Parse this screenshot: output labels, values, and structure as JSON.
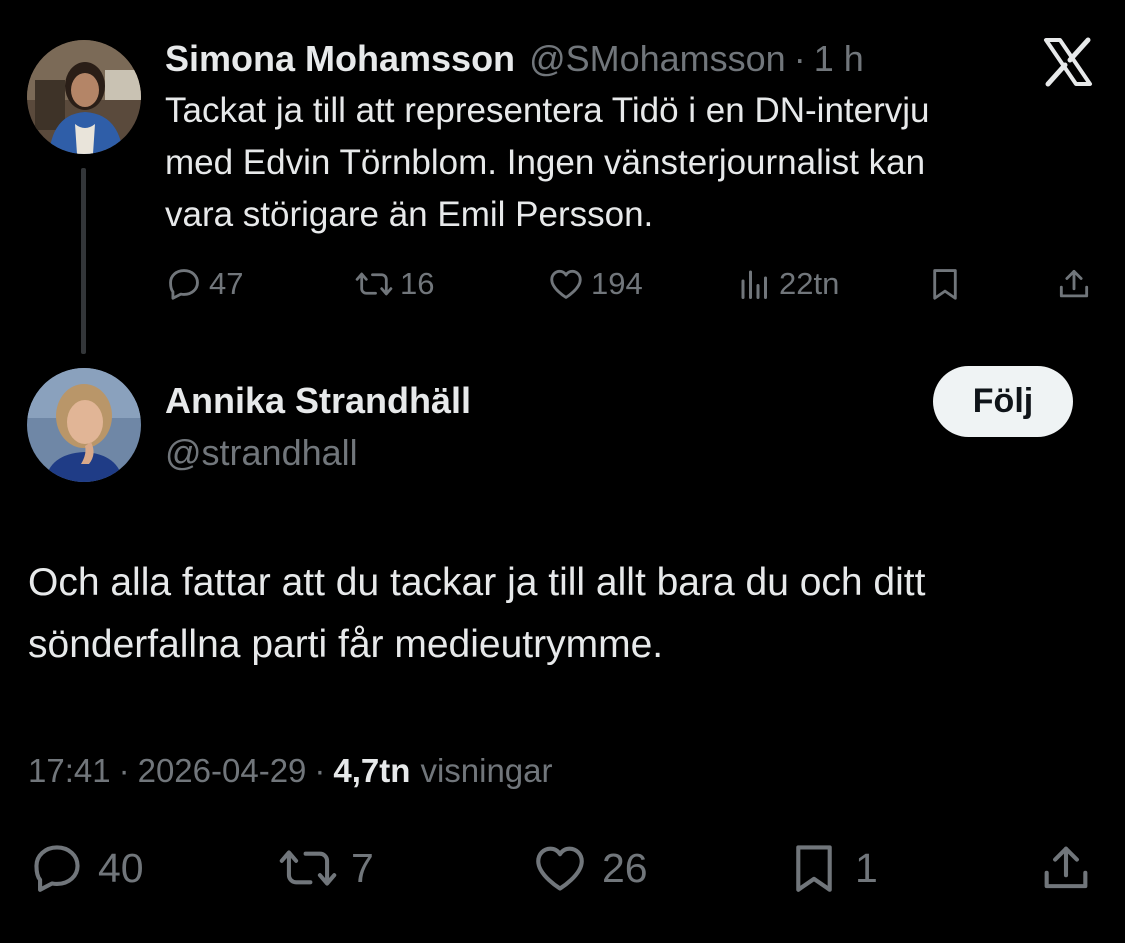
{
  "quoted_tweet": {
    "author_name": "Simona Mohamsson",
    "author_handle": "@SMohamsson",
    "separator": "·",
    "time": "1 h",
    "text": "Tackat ja till att representera Tidö i en DN-intervju med Edvin Törnblom. Ingen vänsterjournalist kan vara störigare än Emil Persson.",
    "text_lines": [
      "Tackat ja till att representera Tidö i en DN-intervju",
      "med Edvin Törnblom. Ingen vänsterjournalist kan",
      "vara störigare än Emil Persson."
    ],
    "actions": {
      "replies": "47",
      "reposts": "16",
      "likes": "194",
      "views": "22tn"
    }
  },
  "x_logo": "X",
  "main_tweet": {
    "author_name": "Annika Strandhäll",
    "author_handle": "@strandhall",
    "follow_label": "Följ",
    "text_lines": [
      "Och alla fattar att du tackar ja till allt bara du och ditt",
      "sönderfallna parti får medieutrymme."
    ],
    "time": "17:41",
    "date": "2026-04-29",
    "separator": "·",
    "views_count": "4,7tn",
    "views_label": "visningar",
    "actions": {
      "replies": "40",
      "reposts": "7",
      "likes": "26",
      "bookmarks": "1"
    }
  },
  "colors": {
    "background": "#000000",
    "text": "#e7e9ea",
    "muted": "#71767b",
    "follow_button_bg": "#eff3f4",
    "follow_button_text": "#0f1419"
  }
}
